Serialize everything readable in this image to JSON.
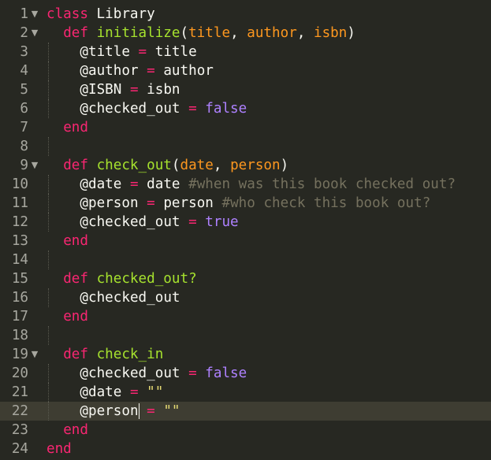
{
  "editor": {
    "theme_colors": {
      "background": "#272822",
      "current_line": "#3e3d32",
      "gutter_text": "#a7a79f",
      "keyword": "#f92672",
      "function": "#a6e22e",
      "parameter": "#fd971f",
      "constant": "#ae81ff",
      "comment": "#75715e",
      "string": "#e6db74",
      "text": "#f8f8f2"
    },
    "current_line": 22,
    "lines": [
      {
        "num": "1",
        "fold": true,
        "indent": 0,
        "tokens": [
          {
            "t": "class",
            "c": "kw"
          },
          {
            "t": " Library",
            "c": "cls"
          }
        ]
      },
      {
        "num": "2",
        "fold": true,
        "indent": 1,
        "tokens": [
          {
            "t": "def",
            "c": "kw"
          },
          {
            "t": " ",
            "c": ""
          },
          {
            "t": "initialize",
            "c": "fn"
          },
          {
            "t": "(",
            "c": ""
          },
          {
            "t": "title",
            "c": "param"
          },
          {
            "t": ", ",
            "c": ""
          },
          {
            "t": "author",
            "c": "param"
          },
          {
            "t": ", ",
            "c": ""
          },
          {
            "t": "isbn",
            "c": "param"
          },
          {
            "t": ")",
            "c": ""
          }
        ]
      },
      {
        "num": "3",
        "fold": false,
        "indent": 2,
        "tokens": [
          {
            "t": "@title",
            "c": "ivar"
          },
          {
            "t": " ",
            "c": ""
          },
          {
            "t": "=",
            "c": "op"
          },
          {
            "t": " title",
            "c": ""
          }
        ]
      },
      {
        "num": "4",
        "fold": false,
        "indent": 2,
        "tokens": [
          {
            "t": "@author",
            "c": "ivar"
          },
          {
            "t": " ",
            "c": ""
          },
          {
            "t": "=",
            "c": "op"
          },
          {
            "t": " author",
            "c": ""
          }
        ]
      },
      {
        "num": "5",
        "fold": false,
        "indent": 2,
        "tokens": [
          {
            "t": "@ISBN",
            "c": "ivar"
          },
          {
            "t": " ",
            "c": ""
          },
          {
            "t": "=",
            "c": "op"
          },
          {
            "t": " isbn",
            "c": ""
          }
        ]
      },
      {
        "num": "6",
        "fold": false,
        "indent": 2,
        "tokens": [
          {
            "t": "@checked_out",
            "c": "ivar"
          },
          {
            "t": " ",
            "c": ""
          },
          {
            "t": "=",
            "c": "op"
          },
          {
            "t": " ",
            "c": ""
          },
          {
            "t": "false",
            "c": "const"
          }
        ]
      },
      {
        "num": "7",
        "fold": false,
        "indent": 1,
        "tokens": [
          {
            "t": "end",
            "c": "kw"
          }
        ]
      },
      {
        "num": "8",
        "fold": false,
        "indent": 1,
        "tokens": []
      },
      {
        "num": "9",
        "fold": true,
        "indent": 1,
        "tokens": [
          {
            "t": "def",
            "c": "kw"
          },
          {
            "t": " ",
            "c": ""
          },
          {
            "t": "check_out",
            "c": "fn"
          },
          {
            "t": "(",
            "c": ""
          },
          {
            "t": "date",
            "c": "param"
          },
          {
            "t": ", ",
            "c": ""
          },
          {
            "t": "person",
            "c": "param"
          },
          {
            "t": ")",
            "c": ""
          }
        ]
      },
      {
        "num": "10",
        "fold": false,
        "indent": 2,
        "tokens": [
          {
            "t": "@date",
            "c": "ivar"
          },
          {
            "t": " ",
            "c": ""
          },
          {
            "t": "=",
            "c": "op"
          },
          {
            "t": " date ",
            "c": ""
          },
          {
            "t": "#when was this book checked out?",
            "c": "comment"
          }
        ]
      },
      {
        "num": "11",
        "fold": false,
        "indent": 2,
        "tokens": [
          {
            "t": "@person",
            "c": "ivar"
          },
          {
            "t": " ",
            "c": ""
          },
          {
            "t": "=",
            "c": "op"
          },
          {
            "t": " person ",
            "c": ""
          },
          {
            "t": "#who check this book out?",
            "c": "comment"
          }
        ]
      },
      {
        "num": "12",
        "fold": false,
        "indent": 2,
        "tokens": [
          {
            "t": "@checked_out",
            "c": "ivar"
          },
          {
            "t": " ",
            "c": ""
          },
          {
            "t": "=",
            "c": "op"
          },
          {
            "t": " ",
            "c": ""
          },
          {
            "t": "true",
            "c": "const"
          }
        ]
      },
      {
        "num": "13",
        "fold": false,
        "indent": 1,
        "tokens": [
          {
            "t": "end",
            "c": "kw"
          }
        ]
      },
      {
        "num": "14",
        "fold": false,
        "indent": 1,
        "tokens": []
      },
      {
        "num": "15",
        "fold": false,
        "indent": 1,
        "tokens": [
          {
            "t": "def",
            "c": "kw"
          },
          {
            "t": " ",
            "c": ""
          },
          {
            "t": "checked_out?",
            "c": "fn"
          }
        ]
      },
      {
        "num": "16",
        "fold": false,
        "indent": 2,
        "tokens": [
          {
            "t": "@checked_out",
            "c": "ivar"
          }
        ]
      },
      {
        "num": "17",
        "fold": false,
        "indent": 1,
        "tokens": [
          {
            "t": "end",
            "c": "kw"
          }
        ]
      },
      {
        "num": "18",
        "fold": false,
        "indent": 1,
        "tokens": []
      },
      {
        "num": "19",
        "fold": true,
        "indent": 1,
        "tokens": [
          {
            "t": "def",
            "c": "kw"
          },
          {
            "t": " ",
            "c": ""
          },
          {
            "t": "check_in",
            "c": "fn"
          }
        ]
      },
      {
        "num": "20",
        "fold": false,
        "indent": 2,
        "tokens": [
          {
            "t": "@checked_out",
            "c": "ivar"
          },
          {
            "t": " ",
            "c": ""
          },
          {
            "t": "=",
            "c": "op"
          },
          {
            "t": " ",
            "c": ""
          },
          {
            "t": "false",
            "c": "const"
          }
        ]
      },
      {
        "num": "21",
        "fold": false,
        "indent": 2,
        "tokens": [
          {
            "t": "@date",
            "c": "ivar"
          },
          {
            "t": " ",
            "c": ""
          },
          {
            "t": "=",
            "c": "op"
          },
          {
            "t": " ",
            "c": ""
          },
          {
            "t": "\"\"",
            "c": "str"
          }
        ]
      },
      {
        "num": "22",
        "fold": false,
        "indent": 2,
        "cursor_after_token": 0,
        "tokens": [
          {
            "t": "@person",
            "c": "ivar"
          },
          {
            "t": " ",
            "c": ""
          },
          {
            "t": "=",
            "c": "op"
          },
          {
            "t": " ",
            "c": ""
          },
          {
            "t": "\"\"",
            "c": "str"
          }
        ]
      },
      {
        "num": "23",
        "fold": false,
        "indent": 1,
        "tokens": [
          {
            "t": "end",
            "c": "kw"
          }
        ]
      },
      {
        "num": "24",
        "fold": false,
        "indent": 0,
        "tokens": [
          {
            "t": "end",
            "c": "kw"
          }
        ]
      }
    ]
  }
}
